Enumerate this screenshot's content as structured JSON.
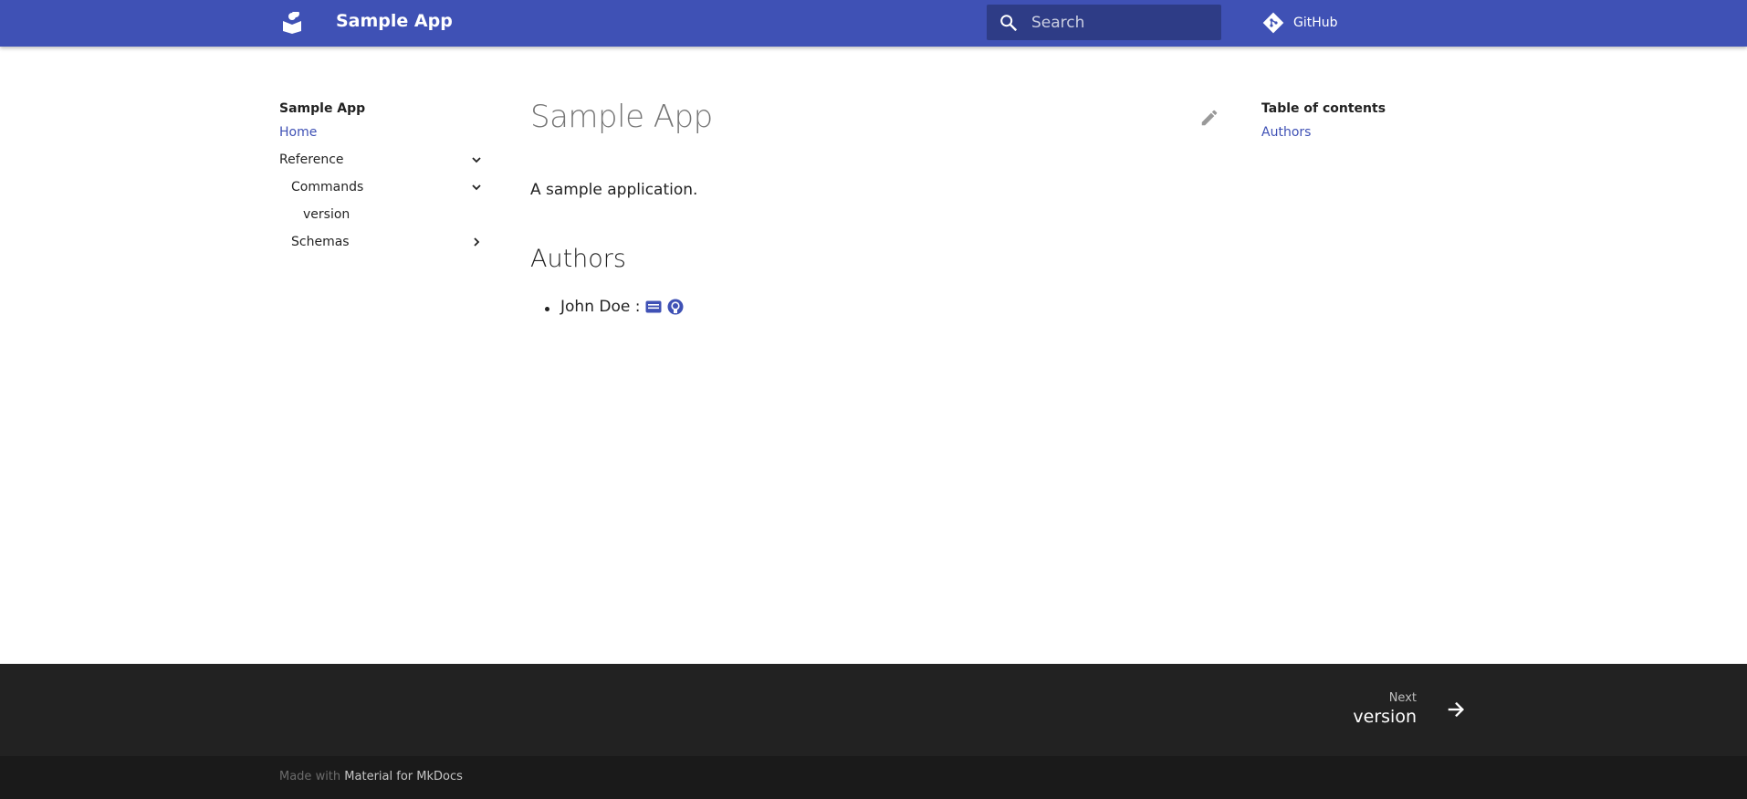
{
  "header": {
    "site_title": "Sample App",
    "logo_icon": "book-icon",
    "search_placeholder": "Search",
    "source_label": "GitHub",
    "source_icon": "git-icon",
    "brand_color": "#3f51b5"
  },
  "nav": {
    "title": "Sample App",
    "items": [
      {
        "label": "Home",
        "active": true
      },
      {
        "label": "Reference",
        "expanded": true
      },
      {
        "label": "Commands",
        "expanded": true
      },
      {
        "label": "version"
      },
      {
        "label": "Schemas",
        "expanded": false
      }
    ]
  },
  "content": {
    "title": "Sample App",
    "lead": "A sample application.",
    "authors_heading": "Authors",
    "authors": [
      {
        "name": "John Doe :",
        "icons": [
          "email-icon",
          "github-icon"
        ]
      }
    ]
  },
  "toc": {
    "title": "Table of contents",
    "links": [
      "Authors"
    ]
  },
  "footer": {
    "next_label": "Next",
    "next_title": "version",
    "made_with_prefix": "Made with",
    "made_with_link": "Material for MkDocs"
  }
}
